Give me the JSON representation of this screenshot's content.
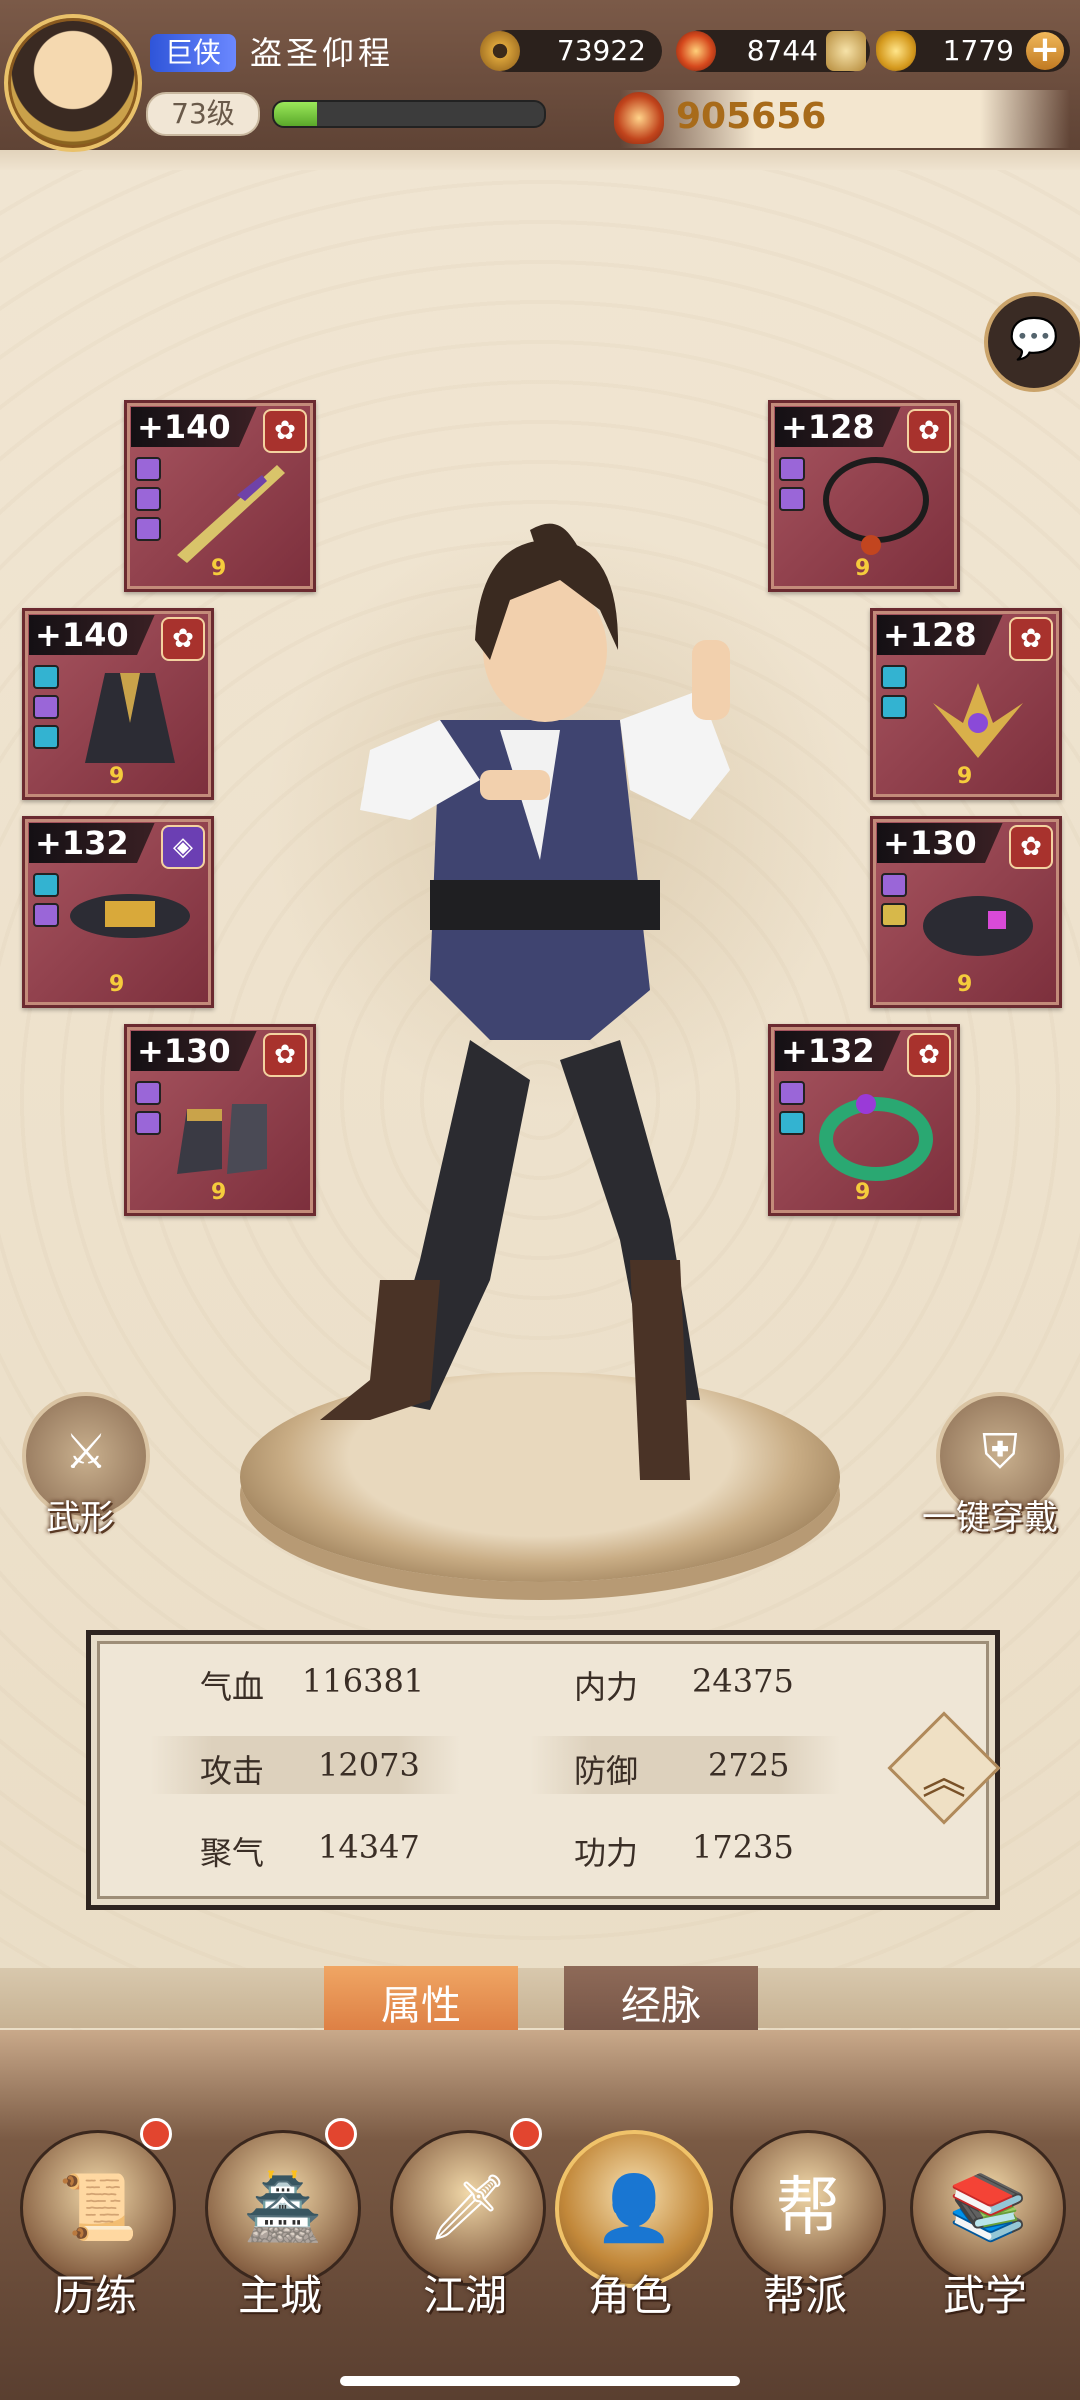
{
  "header": {
    "rank_badge": "巨侠",
    "player_name": "盗圣仰程",
    "level": "73级",
    "xp_fraction": 0.16,
    "copper": "73922",
    "flame_currency": "8744",
    "gold_ingots": "1779",
    "combat_power": "905656"
  },
  "equipment": [
    {
      "id": "weapon",
      "enhance": "+140",
      "quality_icon": "flower-icon",
      "quality_color": "#a8322d",
      "gems": [
        "purple",
        "purple",
        "purple"
      ],
      "art_icon": "sword-icon"
    },
    {
      "id": "armor",
      "enhance": "+140",
      "quality_icon": "flower-icon",
      "quality_color": "#a8322d",
      "gems": [
        "blue",
        "purple",
        "blue"
      ],
      "art_icon": "robe-icon"
    },
    {
      "id": "belt",
      "enhance": "+132",
      "quality_icon": "diamond-icon",
      "quality_color": "#6b3fb3",
      "gems": [
        "blue",
        "purple"
      ],
      "art_icon": "belt-icon"
    },
    {
      "id": "boots",
      "enhance": "+130",
      "quality_icon": "flower-icon",
      "quality_color": "#a8322d",
      "gems": [
        "purple",
        "purple"
      ],
      "art_icon": "boots-icon"
    },
    {
      "id": "necklace",
      "enhance": "+128",
      "quality_icon": "flower-icon",
      "quality_color": "#a8322d",
      "gems": [
        "purple",
        "purple"
      ],
      "art_icon": "necklace-icon"
    },
    {
      "id": "headpiece",
      "enhance": "+128",
      "quality_icon": "flower-icon",
      "quality_color": "#a8322d",
      "gems": [
        "blue",
        "blue"
      ],
      "art_icon": "crest-icon"
    },
    {
      "id": "bracer",
      "enhance": "+130",
      "quality_icon": "flower-icon",
      "quality_color": "#a8322d",
      "gems": [
        "purple",
        "yellow"
      ],
      "art_icon": "bracer-icon"
    },
    {
      "id": "ring",
      "enhance": "+132",
      "quality_icon": "flower-icon",
      "quality_color": "#a8322d",
      "gems": [
        "purple",
        "blue"
      ],
      "art_icon": "jade-ring-icon"
    }
  ],
  "side_buttons": {
    "left_label": "武形",
    "right_label": "一键穿戴"
  },
  "stats": {
    "hp_label": "气血",
    "hp_value": "116381",
    "inner_label": "内力",
    "inner_value": "24375",
    "attack_label": "攻击",
    "attack_value": "12073",
    "defense_label": "防御",
    "defense_value": "2725",
    "focus_label": "聚气",
    "focus_value": "14347",
    "skill_label": "功力",
    "skill_value": "17235"
  },
  "tabs": {
    "attributes": "属性",
    "meridians": "经脉"
  },
  "nav": {
    "items": [
      {
        "label": "历练",
        "icon": "scroll-icon",
        "badge": true
      },
      {
        "label": "主城",
        "icon": "palace-icon",
        "badge": true
      },
      {
        "label": "江湖",
        "icon": "sword-cloud-icon",
        "badge": true
      },
      {
        "label": "角色",
        "icon": "hero-portrait-icon",
        "badge": false,
        "active": true
      },
      {
        "label": "帮派",
        "icon": "guild-emblem-icon",
        "badge": false
      },
      {
        "label": "武学",
        "icon": "books-icon",
        "badge": false
      }
    ]
  },
  "colors": {
    "accent_orange": "#d7733a",
    "card_red": "#8c3b47",
    "power_gold": "#a86b1a"
  }
}
